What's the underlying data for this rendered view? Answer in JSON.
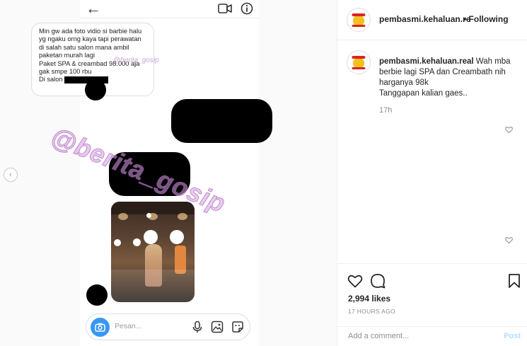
{
  "media": {
    "message_lines": [
      "Min gw ada foto vidio si barbie halu",
      "yg ngaku orng kaya tapi perawatan",
      "di salah satu salon mana ambil",
      "paketan murah lagi",
      "Paket SPA & creambad 98.000 aja",
      "gak smpe 100 rbu",
      "Di salon"
    ],
    "watermark_small": "@berita_gosip",
    "watermark_large": "@berita_gosip",
    "input_placeholder": "Pesan..."
  },
  "post": {
    "username": "pembasmi.kehaluan.real",
    "follow_label": "Following",
    "caption_user": "pembasmi.kehaluan.real",
    "caption_lines": [
      "Wah mba",
      "berbie lagi SPA dan Creambath nih",
      "harganya 98k",
      "Tanggapan kalian gaes.."
    ],
    "time": "17h",
    "likes": "2,994 likes",
    "ago": "17 HOURS AGO",
    "comment_placeholder": "Add a comment...",
    "post_label": "Post"
  },
  "colors": {
    "accent": "#3897f0",
    "watermark": "#d7a0e1"
  }
}
